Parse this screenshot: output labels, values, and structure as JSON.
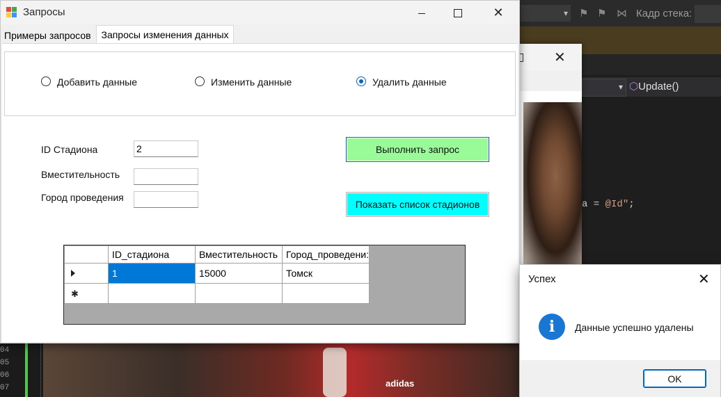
{
  "background_ide": {
    "stack_frame_label": "Кадр стека:",
    "nav_method": "Update()",
    "code_fragment_plain": "a = ",
    "code_fragment_string": "@Id\"",
    "code_fragment_tail": ";",
    "line_numbers": [
      "04",
      "05",
      "06",
      "07"
    ],
    "video_logo_text": "adidas"
  },
  "main_window": {
    "title": "Запросы",
    "tabs": [
      {
        "label": "Примеры запросов",
        "active": false
      },
      {
        "label": "Запросы изменения данных",
        "active": true
      }
    ],
    "radios": [
      {
        "label": "Добавить данные",
        "checked": false
      },
      {
        "label": "Изменить данные",
        "checked": false
      },
      {
        "label": "Удалить данные",
        "checked": true
      }
    ],
    "fields": [
      {
        "label": "ID Стадиона",
        "value": "2"
      },
      {
        "label": "Вместительность",
        "value": ""
      },
      {
        "label": "Город проведения",
        "value": ""
      }
    ],
    "buttons": {
      "execute": "Выполнить запрос",
      "show_list": "Показать список стадионов"
    },
    "grid": {
      "columns": [
        "ID_стадиона",
        "Вместительность",
        "Город_проведени:"
      ],
      "rows": [
        [
          "1",
          "15000",
          "Томск"
        ]
      ]
    }
  },
  "message_box": {
    "title": "Успех",
    "text": "Данные успешно удалены",
    "ok": "OK"
  },
  "colors": {
    "execute_button": "#98fb98",
    "show_list_button": "#00ffff",
    "selection": "#0078d7",
    "accent": "#0067c0"
  }
}
